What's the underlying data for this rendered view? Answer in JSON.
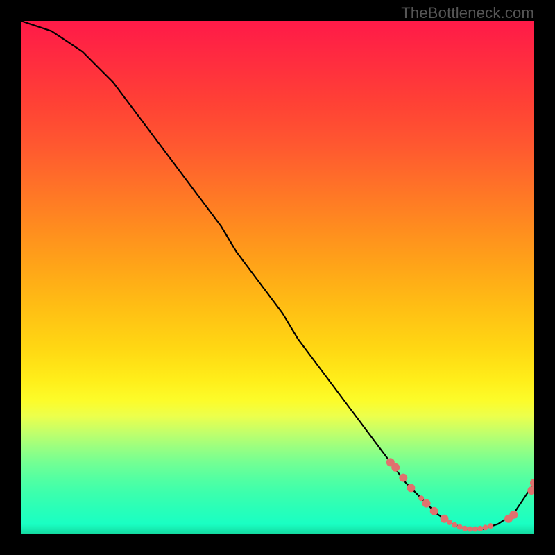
{
  "watermark": "TheBottleneck.com",
  "chart_data": {
    "type": "line",
    "title": "",
    "xlabel": "",
    "ylabel": "",
    "xlim": [
      0,
      100
    ],
    "ylim": [
      0,
      100
    ],
    "grid": false,
    "legend": false,
    "series": [
      {
        "name": "curve",
        "color": "#000000",
        "x": [
          0,
          3,
          6,
          9,
          12,
          15,
          18,
          21,
          24,
          27,
          30,
          33,
          36,
          39,
          42,
          45,
          48,
          51,
          54,
          57,
          60,
          63,
          66,
          69,
          72,
          75,
          78,
          81,
          84,
          87,
          90,
          93,
          96,
          98,
          100
        ],
        "y": [
          100,
          99,
          98,
          96,
          94,
          91,
          88,
          84,
          80,
          76,
          72,
          68,
          64,
          60,
          55,
          51,
          47,
          43,
          38,
          34,
          30,
          26,
          22,
          18,
          14,
          10,
          7,
          4,
          2,
          1,
          1,
          2,
          4,
          7,
          10
        ]
      }
    ],
    "markers": {
      "name": "highlight-points",
      "color": "#e0716e",
      "radius_large": 6,
      "radius_small": 4,
      "points": [
        {
          "x": 72,
          "y": 14,
          "r": "large"
        },
        {
          "x": 73,
          "y": 13,
          "r": "large"
        },
        {
          "x": 74.5,
          "y": 11,
          "r": "large"
        },
        {
          "x": 76,
          "y": 9,
          "r": "large"
        },
        {
          "x": 78,
          "y": 7,
          "r": "small"
        },
        {
          "x": 79,
          "y": 6,
          "r": "large"
        },
        {
          "x": 80.5,
          "y": 4.5,
          "r": "large"
        },
        {
          "x": 82.5,
          "y": 3,
          "r": "large"
        },
        {
          "x": 83.5,
          "y": 2.3,
          "r": "small"
        },
        {
          "x": 84.5,
          "y": 1.8,
          "r": "small"
        },
        {
          "x": 85.5,
          "y": 1.4,
          "r": "small"
        },
        {
          "x": 86.5,
          "y": 1.1,
          "r": "small"
        },
        {
          "x": 87.5,
          "y": 1.0,
          "r": "small"
        },
        {
          "x": 88.5,
          "y": 1.0,
          "r": "small"
        },
        {
          "x": 89.5,
          "y": 1.1,
          "r": "small"
        },
        {
          "x": 90.5,
          "y": 1.3,
          "r": "small"
        },
        {
          "x": 91.5,
          "y": 1.6,
          "r": "small"
        },
        {
          "x": 95,
          "y": 3.0,
          "r": "large"
        },
        {
          "x": 96,
          "y": 3.8,
          "r": "large"
        },
        {
          "x": 99.5,
          "y": 8.5,
          "r": "large"
        },
        {
          "x": 100,
          "y": 10.0,
          "r": "large"
        }
      ]
    }
  }
}
